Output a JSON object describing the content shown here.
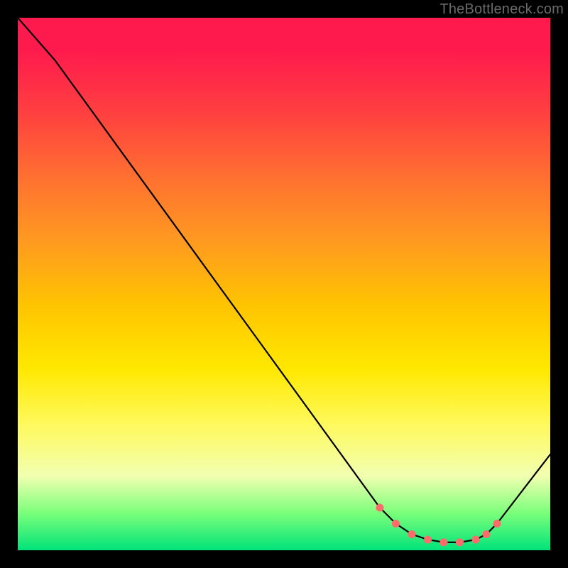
{
  "watermark": "TheBottleneck.com",
  "chart_data": {
    "type": "line",
    "title": "",
    "xlabel": "",
    "ylabel": "",
    "xlim": [
      0,
      100
    ],
    "ylim": [
      0,
      100
    ],
    "grid": false,
    "series": [
      {
        "name": "bottleneck-curve",
        "x": [
          0,
          7,
          68,
          71,
          74,
          77,
          80,
          83,
          86,
          88,
          90,
          100
        ],
        "y": [
          100,
          92,
          8,
          5,
          3,
          2,
          1.5,
          1.5,
          2,
          3,
          5,
          18
        ]
      }
    ],
    "markers": {
      "name": "highlight-points",
      "x": [
        68,
        71,
        74,
        77,
        80,
        83,
        86,
        88,
        90
      ],
      "y": [
        8,
        5,
        3,
        2,
        1.5,
        1.5,
        2,
        3,
        5
      ],
      "color": "#ff6b6b"
    },
    "background_gradient": {
      "direction": "vertical",
      "stops": [
        {
          "pos": 0.0,
          "color": "#ff1a4d"
        },
        {
          "pos": 0.4,
          "color": "#ff9a20"
        },
        {
          "pos": 0.66,
          "color": "#ffe800"
        },
        {
          "pos": 0.93,
          "color": "#7bff7b"
        },
        {
          "pos": 1.0,
          "color": "#00e37a"
        }
      ]
    }
  }
}
